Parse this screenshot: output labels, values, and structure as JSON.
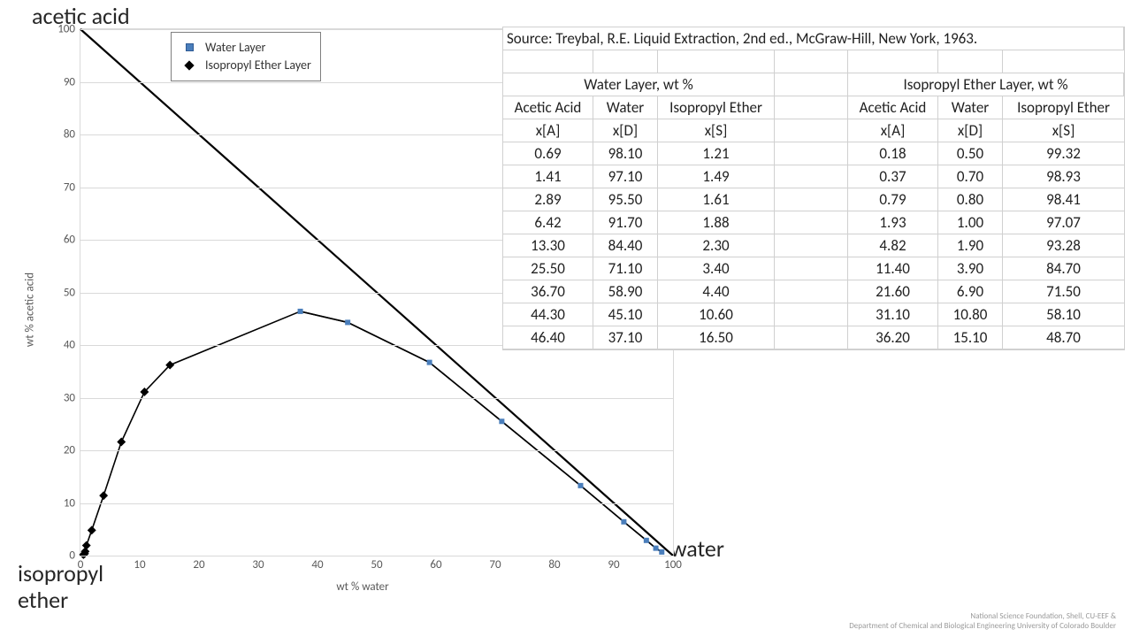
{
  "source_line": "Source: Treybal, R.E. Liquid Extraction, 2nd ed., McGraw-Hill, New York, 1963.",
  "vertex_labels": {
    "top": "acetic acid",
    "left": "isopropyl\nether",
    "right": "water"
  },
  "axis": {
    "x_title": "wt % water",
    "y_title": "wt % acetic acid"
  },
  "legend": {
    "s0": "Water Layer",
    "s1": "Isopropyl Ether Layer"
  },
  "table": {
    "group_water": "Water Layer, wt %",
    "group_ether": "Isopropyl Ether Layer, wt %",
    "sub": {
      "aa": "Acetic Acid",
      "w": "Water",
      "ie": "Isopropyl Ether"
    },
    "sym": {
      "aa": "x[A]",
      "w": "x[D]",
      "ie": "x[S]"
    },
    "rows": [
      [
        "0.69",
        "98.10",
        "1.21",
        "0.18",
        "0.50",
        "99.32"
      ],
      [
        "1.41",
        "97.10",
        "1.49",
        "0.37",
        "0.70",
        "98.93"
      ],
      [
        "2.89",
        "95.50",
        "1.61",
        "0.79",
        "0.80",
        "98.41"
      ],
      [
        "6.42",
        "91.70",
        "1.88",
        "1.93",
        "1.00",
        "97.07"
      ],
      [
        "13.30",
        "84.40",
        "2.30",
        "4.82",
        "1.90",
        "93.28"
      ],
      [
        "25.50",
        "71.10",
        "3.40",
        "11.40",
        "3.90",
        "84.70"
      ],
      [
        "36.70",
        "58.90",
        "4.40",
        "21.60",
        "6.90",
        "71.50"
      ],
      [
        "44.30",
        "45.10",
        "10.60",
        "31.10",
        "10.80",
        "58.10"
      ],
      [
        "46.40",
        "37.10",
        "16.50",
        "36.20",
        "15.10",
        "48.70"
      ]
    ]
  },
  "footer": {
    "l1": "National Science Foundation, Shell, CU-EEF &",
    "l2": "Department of Chemical and Biological Engineering      University of Colorado Boulder"
  },
  "chart_data": {
    "type": "line",
    "xlabel": "wt % water",
    "ylabel": "wt % acetic acid",
    "xlim": [
      0,
      100
    ],
    "ylim": [
      0,
      100
    ],
    "x_ticks": [
      0,
      10,
      20,
      30,
      40,
      50,
      60,
      70,
      80,
      90,
      100
    ],
    "y_ticks": [
      0,
      10,
      20,
      30,
      40,
      50,
      60,
      70,
      80,
      90,
      100
    ],
    "series": [
      {
        "name": "Water Layer",
        "marker": "square",
        "color": "#4a7ebb",
        "points": [
          [
            98.1,
            0.69
          ],
          [
            97.1,
            1.41
          ],
          [
            95.5,
            2.89
          ],
          [
            91.7,
            6.42
          ],
          [
            84.4,
            13.3
          ],
          [
            71.1,
            25.5
          ],
          [
            58.9,
            36.7
          ],
          [
            45.1,
            44.3
          ],
          [
            37.1,
            46.4
          ]
        ]
      },
      {
        "name": "Isopropyl Ether Layer",
        "marker": "diamond",
        "color": "#000000",
        "points": [
          [
            0.5,
            0.18
          ],
          [
            0.7,
            0.37
          ],
          [
            0.8,
            0.79
          ],
          [
            1.0,
            1.93
          ],
          [
            1.9,
            4.82
          ],
          [
            3.9,
            11.4
          ],
          [
            6.9,
            21.6
          ],
          [
            10.8,
            31.1
          ],
          [
            15.1,
            36.2
          ]
        ]
      },
      {
        "name": "diagonal",
        "marker": "none",
        "color": "#000000",
        "points": [
          [
            0,
            100
          ],
          [
            100,
            0
          ]
        ]
      }
    ]
  }
}
